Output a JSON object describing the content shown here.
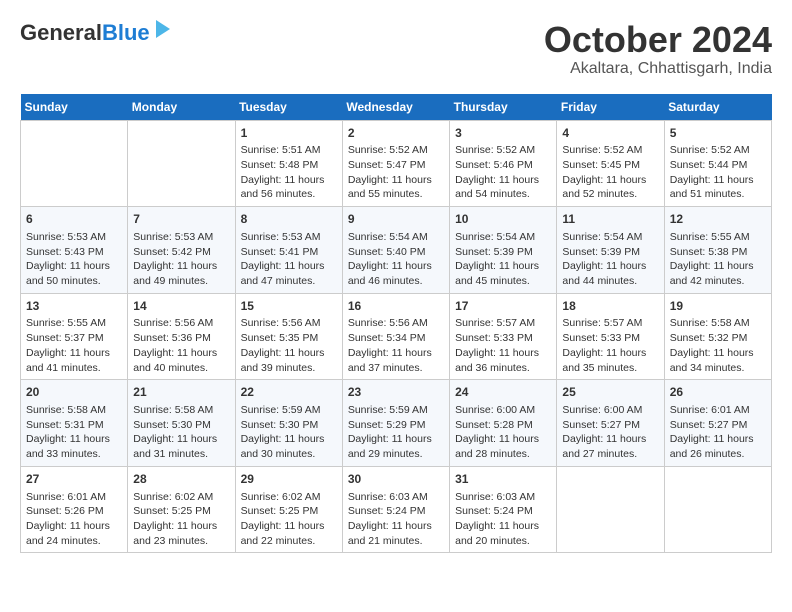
{
  "logo": {
    "general": "General",
    "blue": "Blue"
  },
  "title": "October 2024",
  "subtitle": "Akaltara, Chhattisgarh, India",
  "days": [
    "Sunday",
    "Monday",
    "Tuesday",
    "Wednesday",
    "Thursday",
    "Friday",
    "Saturday"
  ],
  "weeks": [
    [
      {
        "day": "",
        "content": ""
      },
      {
        "day": "",
        "content": ""
      },
      {
        "day": "1",
        "content": "Sunrise: 5:51 AM\nSunset: 5:48 PM\nDaylight: 11 hours and 56 minutes."
      },
      {
        "day": "2",
        "content": "Sunrise: 5:52 AM\nSunset: 5:47 PM\nDaylight: 11 hours and 55 minutes."
      },
      {
        "day": "3",
        "content": "Sunrise: 5:52 AM\nSunset: 5:46 PM\nDaylight: 11 hours and 54 minutes."
      },
      {
        "day": "4",
        "content": "Sunrise: 5:52 AM\nSunset: 5:45 PM\nDaylight: 11 hours and 52 minutes."
      },
      {
        "day": "5",
        "content": "Sunrise: 5:52 AM\nSunset: 5:44 PM\nDaylight: 11 hours and 51 minutes."
      }
    ],
    [
      {
        "day": "6",
        "content": "Sunrise: 5:53 AM\nSunset: 5:43 PM\nDaylight: 11 hours and 50 minutes."
      },
      {
        "day": "7",
        "content": "Sunrise: 5:53 AM\nSunset: 5:42 PM\nDaylight: 11 hours and 49 minutes."
      },
      {
        "day": "8",
        "content": "Sunrise: 5:53 AM\nSunset: 5:41 PM\nDaylight: 11 hours and 47 minutes."
      },
      {
        "day": "9",
        "content": "Sunrise: 5:54 AM\nSunset: 5:40 PM\nDaylight: 11 hours and 46 minutes."
      },
      {
        "day": "10",
        "content": "Sunrise: 5:54 AM\nSunset: 5:39 PM\nDaylight: 11 hours and 45 minutes."
      },
      {
        "day": "11",
        "content": "Sunrise: 5:54 AM\nSunset: 5:39 PM\nDaylight: 11 hours and 44 minutes."
      },
      {
        "day": "12",
        "content": "Sunrise: 5:55 AM\nSunset: 5:38 PM\nDaylight: 11 hours and 42 minutes."
      }
    ],
    [
      {
        "day": "13",
        "content": "Sunrise: 5:55 AM\nSunset: 5:37 PM\nDaylight: 11 hours and 41 minutes."
      },
      {
        "day": "14",
        "content": "Sunrise: 5:56 AM\nSunset: 5:36 PM\nDaylight: 11 hours and 40 minutes."
      },
      {
        "day": "15",
        "content": "Sunrise: 5:56 AM\nSunset: 5:35 PM\nDaylight: 11 hours and 39 minutes."
      },
      {
        "day": "16",
        "content": "Sunrise: 5:56 AM\nSunset: 5:34 PM\nDaylight: 11 hours and 37 minutes."
      },
      {
        "day": "17",
        "content": "Sunrise: 5:57 AM\nSunset: 5:33 PM\nDaylight: 11 hours and 36 minutes."
      },
      {
        "day": "18",
        "content": "Sunrise: 5:57 AM\nSunset: 5:33 PM\nDaylight: 11 hours and 35 minutes."
      },
      {
        "day": "19",
        "content": "Sunrise: 5:58 AM\nSunset: 5:32 PM\nDaylight: 11 hours and 34 minutes."
      }
    ],
    [
      {
        "day": "20",
        "content": "Sunrise: 5:58 AM\nSunset: 5:31 PM\nDaylight: 11 hours and 33 minutes."
      },
      {
        "day": "21",
        "content": "Sunrise: 5:58 AM\nSunset: 5:30 PM\nDaylight: 11 hours and 31 minutes."
      },
      {
        "day": "22",
        "content": "Sunrise: 5:59 AM\nSunset: 5:30 PM\nDaylight: 11 hours and 30 minutes."
      },
      {
        "day": "23",
        "content": "Sunrise: 5:59 AM\nSunset: 5:29 PM\nDaylight: 11 hours and 29 minutes."
      },
      {
        "day": "24",
        "content": "Sunrise: 6:00 AM\nSunset: 5:28 PM\nDaylight: 11 hours and 28 minutes."
      },
      {
        "day": "25",
        "content": "Sunrise: 6:00 AM\nSunset: 5:27 PM\nDaylight: 11 hours and 27 minutes."
      },
      {
        "day": "26",
        "content": "Sunrise: 6:01 AM\nSunset: 5:27 PM\nDaylight: 11 hours and 26 minutes."
      }
    ],
    [
      {
        "day": "27",
        "content": "Sunrise: 6:01 AM\nSunset: 5:26 PM\nDaylight: 11 hours and 24 minutes."
      },
      {
        "day": "28",
        "content": "Sunrise: 6:02 AM\nSunset: 5:25 PM\nDaylight: 11 hours and 23 minutes."
      },
      {
        "day": "29",
        "content": "Sunrise: 6:02 AM\nSunset: 5:25 PM\nDaylight: 11 hours and 22 minutes."
      },
      {
        "day": "30",
        "content": "Sunrise: 6:03 AM\nSunset: 5:24 PM\nDaylight: 11 hours and 21 minutes."
      },
      {
        "day": "31",
        "content": "Sunrise: 6:03 AM\nSunset: 5:24 PM\nDaylight: 11 hours and 20 minutes."
      },
      {
        "day": "",
        "content": ""
      },
      {
        "day": "",
        "content": ""
      }
    ]
  ]
}
